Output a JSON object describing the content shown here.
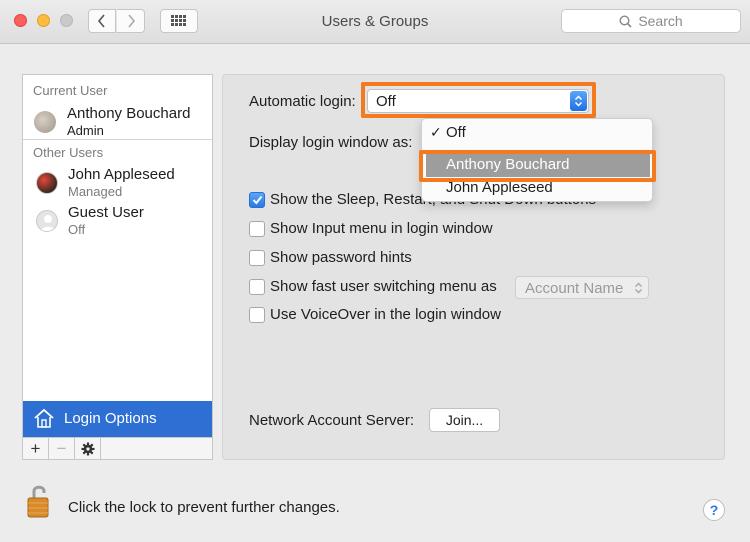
{
  "window": {
    "title": "Users & Groups",
    "search_placeholder": "Search"
  },
  "sidebar": {
    "current_user_label": "Current User",
    "current_user": {
      "name": "Anthony Bouchard",
      "role": "Admin"
    },
    "other_users_label": "Other Users",
    "other_users": [
      {
        "name": "John Appleseed",
        "role": "Managed"
      },
      {
        "name": "Guest User",
        "role": "Off"
      }
    ],
    "login_options_label": "Login Options",
    "toolbar": {
      "add": "+",
      "remove": "−"
    }
  },
  "main": {
    "automatic_login_label": "Automatic login:",
    "automatic_login_value": "Off",
    "display_login_window_label": "Display login window as:",
    "dropdown": {
      "items": [
        {
          "label": "Off",
          "checked": true
        },
        {
          "label": "Anthony Bouchard",
          "highlighted": true
        },
        {
          "label": "John Appleseed"
        }
      ]
    },
    "checkboxes": [
      {
        "label": "Show the Sleep, Restart, and Shut Down buttons",
        "checked": true
      },
      {
        "label": "Show Input menu in login window",
        "checked": false
      },
      {
        "label": "Show password hints",
        "checked": false
      },
      {
        "label": "Show fast user switching menu as",
        "checked": false
      },
      {
        "label": "Use VoiceOver in the login window",
        "checked": false
      }
    ],
    "fast_switch_menu_value": "Account Name",
    "network_account_server_label": "Network Account Server:",
    "join_button_label": "Join..."
  },
  "footer": {
    "lock_text": "Click the lock to prevent further changes.",
    "help_label": "?"
  },
  "colors": {
    "accent": "#2d6fd2",
    "highlight_border": "#f47a20"
  }
}
